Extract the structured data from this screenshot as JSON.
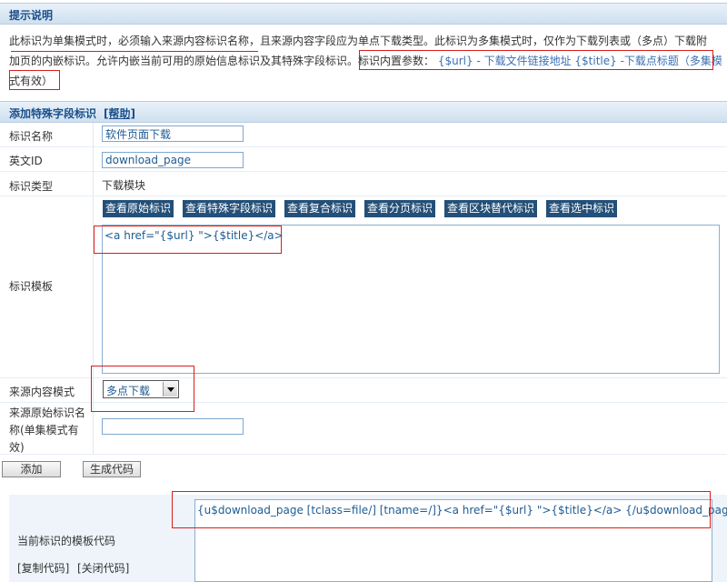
{
  "tips": {
    "title": "提示说明",
    "line1": "此标识为单集模式时，必须输入来源内容标识名称，且来源内容字段应为单点下载类型。此标识为多集模式时，仅作为下载列表或（多点）下载附",
    "line2_a": "加页的内嵌标识。允许内嵌当前可用的原始信息标识及其特殊字段标识。",
    "line2_b": "标识内置参数：",
    "line2_c": " {$url} - 下载文件链接地址 {$title} -下载点标题（多集模",
    "line3": "式有效）"
  },
  "section": {
    "title": "添加特殊字段标识",
    "help": "[帮助]"
  },
  "form": {
    "name_label": "标识名称",
    "name_value": "软件页面下载",
    "en_label": "英文ID",
    "en_value": "download_page",
    "type_label": "标识类型",
    "type_value": "下载模块",
    "template_label": "标识模板",
    "tag_buttons": [
      "查看原始标识",
      "查看特殊字段标识",
      "查看复合标识",
      "查看分页标识",
      "查看区块替代标识",
      "查看选中标识"
    ],
    "template_value": "<a href=\"{$url} \">{$title}</a>",
    "source_mode_label": "来源内容模式",
    "source_mode_value": "多点下载",
    "source_name_label": "来源原始标识名称(单集模式有效)",
    "source_name_value": ""
  },
  "actions": {
    "add": "添加",
    "generate": "生成代码"
  },
  "code": {
    "label": "当前标识的模板代码",
    "copy": "[复制代码]",
    "close": "[关闭代码]",
    "value": "{u$download_page [tclass=file/] [tname=/]}<a href=\"{$url} \">{$title}</a> {/u$download_page}"
  },
  "colors": {
    "accent": "#1a4f8a",
    "tag_button_bg": "#234f78",
    "highlight_red": "#d81e1e"
  }
}
